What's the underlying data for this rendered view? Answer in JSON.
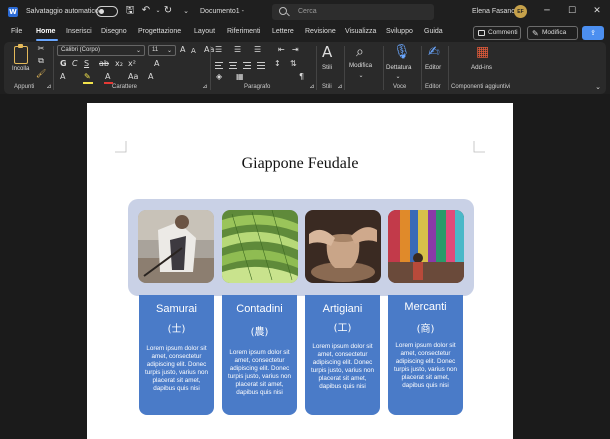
{
  "titlebar": {
    "autosave_label": "Salvataggio automatico",
    "document_title": "Documento1  -",
    "search_placeholder": "Cerca",
    "user_name": "Elena Fasano",
    "user_initials": "EF"
  },
  "menu": {
    "tabs": [
      {
        "label": "File"
      },
      {
        "label": "Home"
      },
      {
        "label": "Inserisci"
      },
      {
        "label": "Disegno"
      },
      {
        "label": "Progettazione"
      },
      {
        "label": "Layout"
      },
      {
        "label": "Riferimenti"
      },
      {
        "label": "Lettere"
      },
      {
        "label": "Revisione"
      },
      {
        "label": "Visualizza"
      },
      {
        "label": "Sviluppo"
      },
      {
        "label": "Guida"
      }
    ],
    "active_tab": "Home",
    "comments_label": "Commenti",
    "edit_label": "Modifica"
  },
  "ribbon": {
    "paste_label": "Incolla",
    "font_name": "Calibri (Corpo)",
    "font_size": "11",
    "groups": {
      "clipboard": "Appunti",
      "font": "Carattere",
      "paragraph": "Paragrafo",
      "styles": "Stili",
      "voice": "Voce",
      "editor": "Editor",
      "addins": "Componenti aggiuntivi"
    },
    "big_buttons": {
      "styles": "Stili",
      "edit": "Modifica",
      "dictate": "Dettatura",
      "editor": "Editor",
      "addins": "Add-ins"
    }
  },
  "document": {
    "title": "Giappone Feudale",
    "columns": [
      {
        "name": "Samurai",
        "kanji": "(士)",
        "text": "Lorem ipsum dolor sit amet, consectetur adipiscing elit. Donec turpis justo, varius non placerat sit amet, dapibus quis nisi"
      },
      {
        "name": "Contadini",
        "kanji": "(農)",
        "text": "Lorem ipsum dolor sit amet, consectetur adipiscing elit. Donec turpis justo, varius non placerat sit amet, dapibus quis nisi"
      },
      {
        "name": "Artigiani",
        "kanji": "(工)",
        "text": "Lorem ipsum dolor sit amet, consectetur adipiscing elit. Donec turpis justo, varius non placerat sit amet, dapibus quis nisi"
      },
      {
        "name": "Mercanti",
        "kanji": "(商)",
        "text": "Lorem ipsum dolor sit amet, consectetur adipiscing elit. Donec turpis justo, varius non placerat sit amet, dapibus quis nisi"
      }
    ]
  },
  "colors": {
    "accent": "#6aa7ff",
    "column_blue": "#4a7bc8",
    "picture_band": "#c9d1e6",
    "ribbon_bg": "#2a2a2a"
  }
}
